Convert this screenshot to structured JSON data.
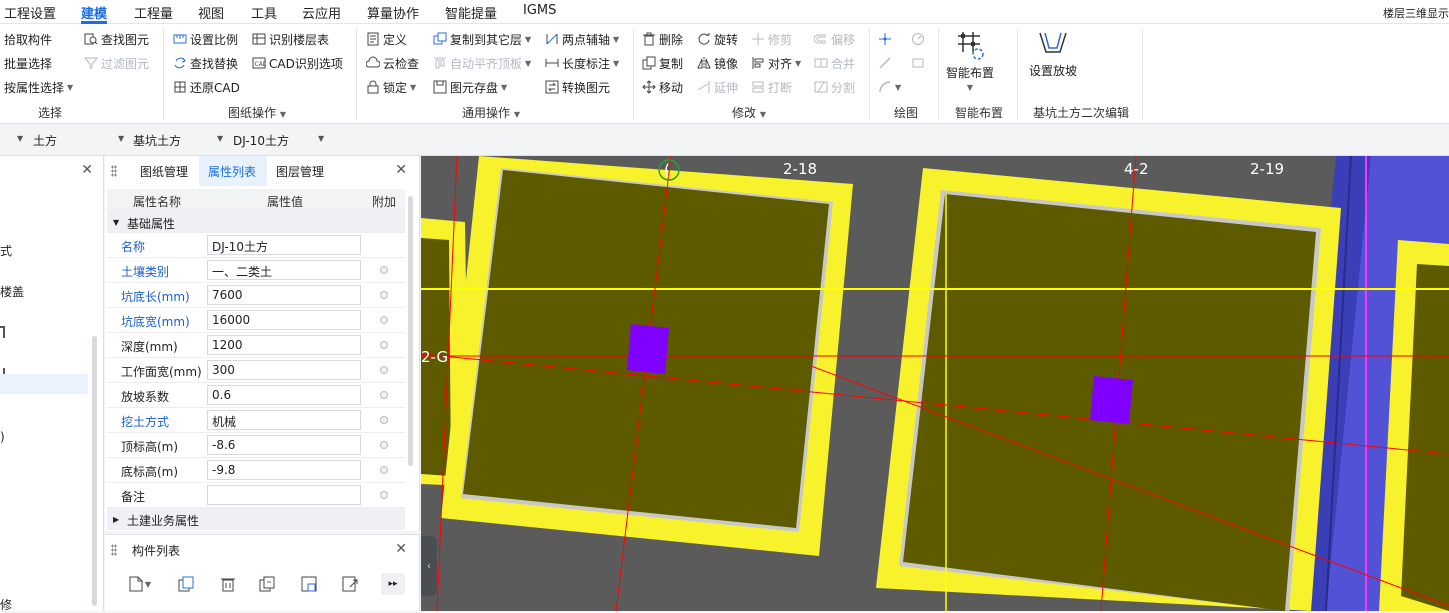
{
  "menu": {
    "items": [
      "工程设置",
      "建模",
      "工程量",
      "视图",
      "工具",
      "云应用",
      "算量协作",
      "智能提量",
      "IGMS"
    ],
    "active": "建模",
    "right_text": "楼层三维显示"
  },
  "ribbon": {
    "select_group": {
      "label": "选择",
      "pick": "拾取构件",
      "batch": "批量选择",
      "by_attr": "按属性选择",
      "find": "查找图元",
      "filter": "过滤图元"
    },
    "drawing_group": {
      "label": "图纸操作",
      "set_scale": "设置比例",
      "find_replace": "查找替换",
      "restore_cad": "还原CAD",
      "recognize_floor": "识别楼层表",
      "cad_options": "CAD识别选项"
    },
    "common_group": {
      "label": "通用操作",
      "define": "定义",
      "cloud_check": "云检查",
      "lock": "锁定",
      "copy_to_floor": "复制到其它层",
      "auto_align": "自动平齐顶板",
      "save_element": "图元存盘",
      "two_point_axis": "两点辅轴",
      "length_dim": "长度标注",
      "convert": "转换图元"
    },
    "modify_group": {
      "label": "修改",
      "delete": "删除",
      "copy": "复制",
      "move": "移动",
      "rotate": "旋转",
      "mirror": "镜像",
      "trim": "修剪",
      "extend": "延伸",
      "align": "对齐",
      "break": "打断",
      "offset": "偏移",
      "merge": "合并",
      "split": "分割"
    },
    "draw_group": {
      "label": "绘图"
    },
    "smart_group": {
      "label": "智能布置",
      "button": "智能布置"
    },
    "pit_group": {
      "label": "基坑土方二次编辑",
      "button": "设置放坡"
    }
  },
  "selectors": [
    "土方",
    "基坑土方",
    "DJ-10土方"
  ],
  "left_nav": {
    "fragments": [
      "式",
      "楼盖",
      "",
      "",
      ")",
      "修"
    ]
  },
  "property_panel": {
    "tabs": [
      "图纸管理",
      "属性列表",
      "图层管理"
    ],
    "active_tab": "属性列表",
    "headers": [
      "属性名称",
      "属性值",
      "附加"
    ],
    "section_basic": "基础属性",
    "section_civil": "土建业务属性",
    "rows": [
      {
        "name": "名称",
        "value": "DJ-10土方",
        "blue": true,
        "extra": false
      },
      {
        "name": "土壤类别",
        "value": "一、二类土",
        "blue": true,
        "extra": true
      },
      {
        "name": "坑底长(mm)",
        "value": "7600",
        "blue": true,
        "extra": true
      },
      {
        "name": "坑底宽(mm)",
        "value": "16000",
        "blue": true,
        "extra": true
      },
      {
        "name": "深度(mm)",
        "value": "1200",
        "blue": false,
        "extra": true
      },
      {
        "name": "工作面宽(mm)",
        "value": "300",
        "blue": false,
        "extra": true
      },
      {
        "name": "放坡系数",
        "value": "0.6",
        "blue": false,
        "extra": true
      },
      {
        "name": "挖土方式",
        "value": "机械",
        "blue": true,
        "extra": true
      },
      {
        "name": "顶标高(m)",
        "value": "-8.6",
        "blue": false,
        "extra": true
      },
      {
        "name": "底标高(m)",
        "value": "-9.8",
        "blue": false,
        "extra": true
      },
      {
        "name": "备注",
        "value": "",
        "blue": false,
        "extra": true
      }
    ]
  },
  "component_list": {
    "title": "构件列表"
  },
  "canvas": {
    "axis_labels": [
      "(",
      "2-18",
      "4-2",
      "2-19",
      "2-G"
    ],
    "colors": {
      "background": "#5b5b5b",
      "pit_border": "#f7f22c",
      "pit_fill": "#5e5a00",
      "inner_line": "#c8c8c8",
      "footing": "#7f00ff",
      "axis_red": "#ff0000",
      "axis_yellow": "#ffff00",
      "wall_blue": "#5252d6",
      "magenta": "#ff33ff"
    }
  }
}
